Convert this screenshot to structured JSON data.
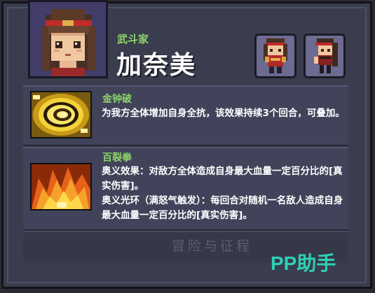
{
  "character": {
    "class_label": "武斗家",
    "name": "加奈美"
  },
  "skills": [
    {
      "name": "金钟破",
      "icon": "golden-spiral-icon",
      "description": [
        "为我方全体增加自身全抗，该效果持续3个回合，可叠加。"
      ]
    },
    {
      "name": "百裂拳",
      "icon": "flame-fist-icon",
      "description": [
        "奥义效果：对敌方全体造成自身最大血量一定百分比的[真实伤害]。",
        "奥义光环（满怒气触发）：每回合对随机一名敌人造成自身最大血量一定百分比的[真实伤害]。"
      ]
    }
  ],
  "watermarks": {
    "game_logo": "冒险与征程",
    "site": "PP助手"
  },
  "colors": {
    "panel": "#3a3d4d",
    "skill_name": "#8ed36a",
    "watermark_site": "#2ed0b6"
  }
}
